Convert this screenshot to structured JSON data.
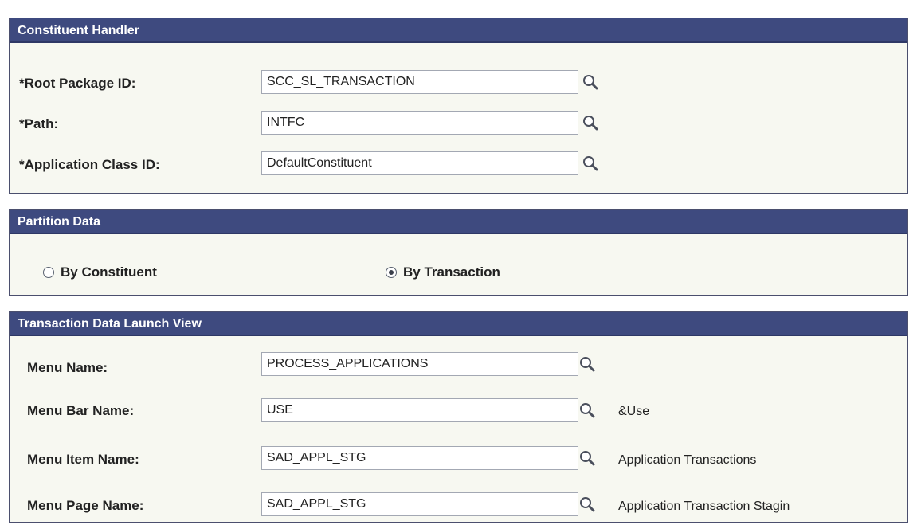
{
  "constituent_handler": {
    "title": "Constituent Handler",
    "fields": [
      {
        "label": "*Root Package ID:",
        "value": "SCC_SL_TRANSACTION"
      },
      {
        "label": "*Path:",
        "value": "INTFC"
      },
      {
        "label": "*Application Class ID:",
        "value": "DefaultConstituent"
      }
    ]
  },
  "partition_data": {
    "title": "Partition Data",
    "options": [
      {
        "label": "By Constituent",
        "selected": false
      },
      {
        "label": "By Transaction",
        "selected": true
      }
    ]
  },
  "launch_view": {
    "title": "Transaction Data Launch View",
    "fields": [
      {
        "label": "Menu Name:",
        "value": "PROCESS_APPLICATIONS",
        "description": ""
      },
      {
        "label": "Menu Bar Name:",
        "value": "USE",
        "description": "&Use"
      },
      {
        "label": "Menu Item Name:",
        "value": "SAD_APPL_STG",
        "description": "Application Transactions"
      },
      {
        "label": "Menu Page Name:",
        "value": "SAD_APPL_STG",
        "description": "Application Transaction Stagin"
      }
    ]
  },
  "icons": {
    "lookup": "magnifier-lookup-icon"
  }
}
